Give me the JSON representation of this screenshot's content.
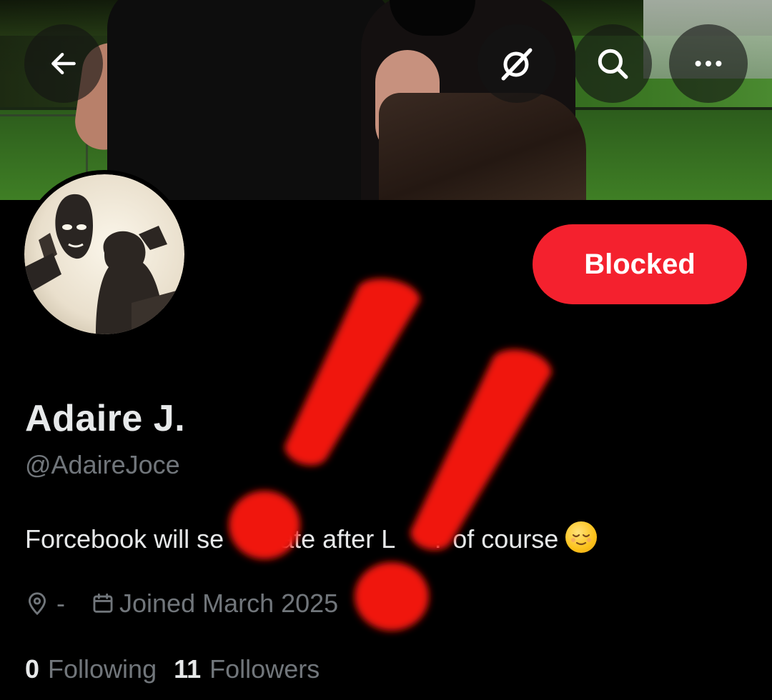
{
  "header": {
    "back_icon": "arrow-left-icon",
    "grok_icon": "grok-icon",
    "search_icon": "search-icon",
    "more_icon": "more-horizontal-icon"
  },
  "profile": {
    "display_name": "Adaire J.",
    "handle": "@AdaireJoce",
    "bio_part1": "Forcebook will se",
    "bio_part2": "ate after L",
    "bio_part3": "? of course",
    "bio_emoji": "relieved-face-emoji",
    "location": "-",
    "joined": "Joined March 2025",
    "following_count": "0",
    "following_label": "Following",
    "followers_count": "11",
    "followers_label": "Followers"
  },
  "actions": {
    "blocked_label": "Blocked"
  },
  "colors": {
    "background": "#000000",
    "primary_text": "#e7e9ea",
    "secondary_text": "#71767b",
    "blocked_button": "#f4212e",
    "overlay_red": "#f0180a"
  }
}
